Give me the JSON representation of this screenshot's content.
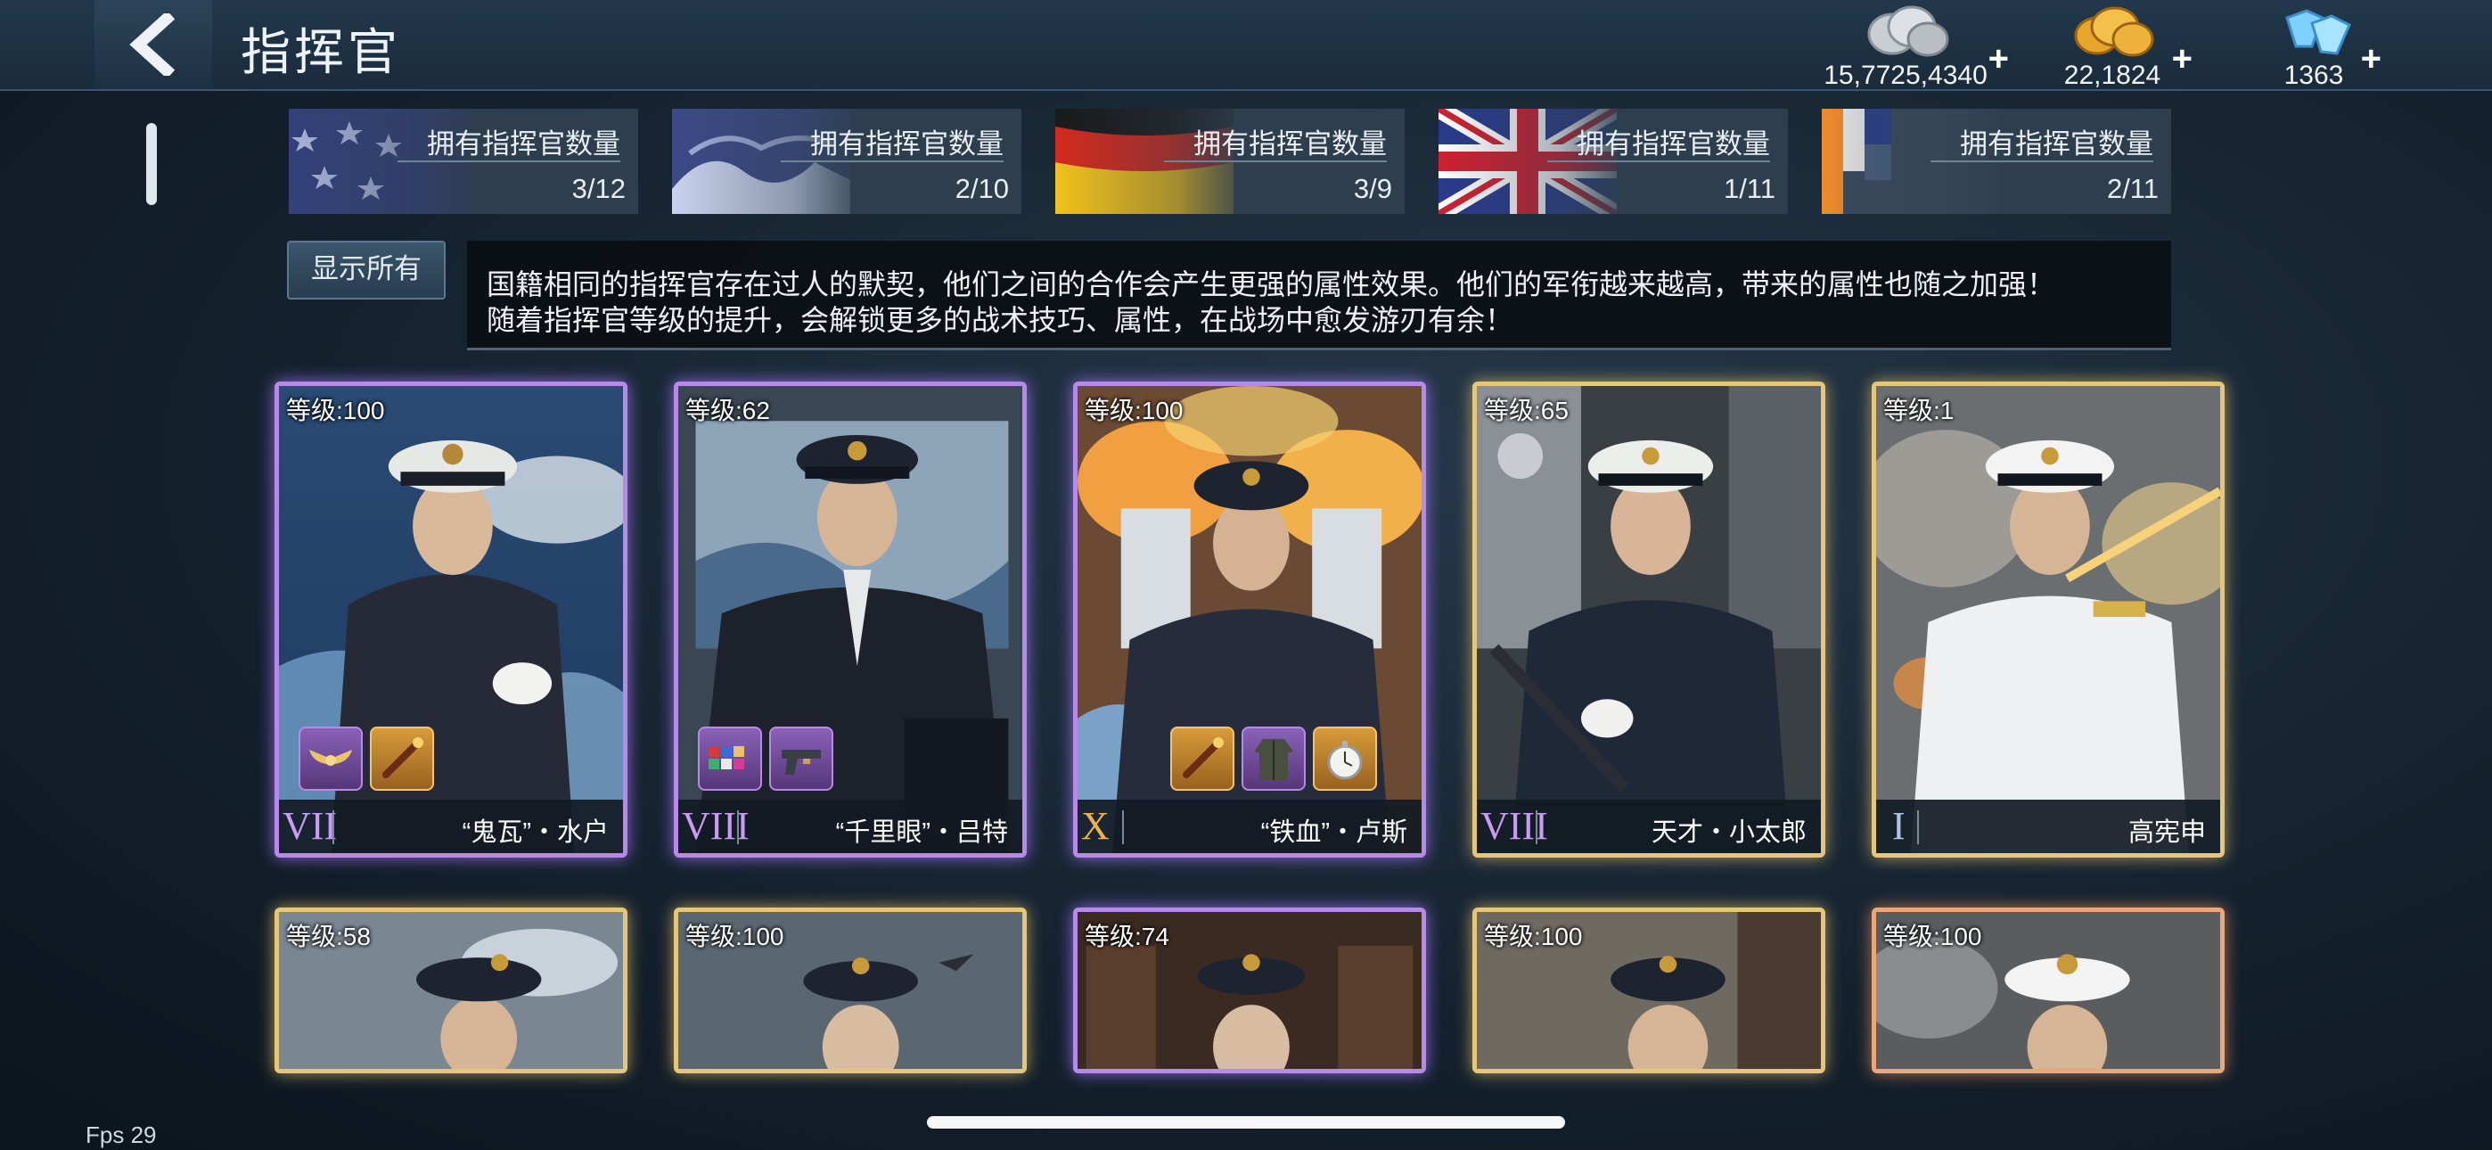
{
  "header": {
    "title": "指挥官",
    "back_icon": "back-arrow-icon",
    "currencies": [
      {
        "name": "silver",
        "amount": "15,7725,4340",
        "icon": "silver-coins-icon"
      },
      {
        "name": "gold",
        "amount": "22,1824",
        "icon": "gold-coins-icon"
      },
      {
        "name": "diamond",
        "amount": "1363",
        "icon": "diamond-icon"
      }
    ],
    "plus": "+"
  },
  "nations": [
    {
      "flag": "usa-flag-icon",
      "label": "拥有指挥官数量",
      "count": "3/12"
    },
    {
      "flag": "japan-flag-icon",
      "label": "拥有指挥官数量",
      "count": "2/10"
    },
    {
      "flag": "germany-flag-icon",
      "label": "拥有指挥官数量",
      "count": "3/9"
    },
    {
      "flag": "uk-flag-icon",
      "label": "拥有指挥官数量",
      "count": "1/11"
    },
    {
      "flag": "other-flag-icon",
      "label": "拥有指挥官数量",
      "count": "2/11"
    }
  ],
  "filter": {
    "show_all": "显示所有"
  },
  "info": {
    "line1": "国籍相同的指挥官存在过人的默契，他们之间的合作会产生更强的属性效果。他们的军衔越来越高，带来的属性也随之加强！",
    "line2": "随着指挥官等级的提升，会解锁更多的战术技巧、属性，在战场中愈发游刃有余！"
  },
  "commanders": [
    {
      "level": "等级:100",
      "rank": "VII",
      "name": "“鬼瓦”・水户",
      "frame": "purple",
      "rank_color": "#c79cf2",
      "equipment": [
        "wings-badge-icon",
        "baton-icon"
      ]
    },
    {
      "level": "等级:62",
      "rank": "VIII",
      "name": "“千里眼”・吕特",
      "frame": "purple",
      "rank_color": "#c79cf2",
      "equipment": [
        "medal-ribbons-icon",
        "pistol-icon"
      ]
    },
    {
      "level": "等级:100",
      "rank": "X",
      "name": "“铁血”・卢斯",
      "frame": "purple",
      "rank_color": "#f0b24a",
      "equipment": [
        "baton-icon",
        "uniform-icon",
        "pocket-watch-icon"
      ]
    },
    {
      "level": "等级:65",
      "rank": "VIII",
      "name": "天才・小太郎",
      "frame": "gold",
      "rank_color": "#c79cf2",
      "equipment": []
    },
    {
      "level": "等级:1",
      "rank": "I",
      "name": "高宪申",
      "frame": "gold",
      "rank_color": "#a9c6e6",
      "equipment": []
    },
    {
      "level": "等级:58",
      "frame": "gold"
    },
    {
      "level": "等级:100",
      "frame": "gold"
    },
    {
      "level": "等级:74",
      "frame": "purple"
    },
    {
      "level": "等级:100",
      "frame": "gold"
    },
    {
      "level": "等级:100",
      "frame": "orange"
    }
  ],
  "footer": {
    "fps": "Fps 29"
  }
}
